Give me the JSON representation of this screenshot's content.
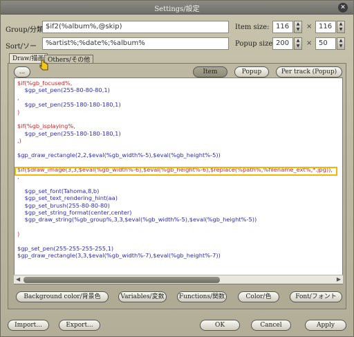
{
  "window": {
    "title": "Settings/設定",
    "close_glyph": "✕"
  },
  "form": {
    "group_label": "Group/分類:",
    "group_value": "$if2(%album%,@skip)",
    "sort_label": "Sort/ソー",
    "sort_value": "%artist%;%date%;%album%",
    "item_size_label": "Item size:",
    "item_size_w": "116",
    "item_size_h": "116",
    "popup_size_label": "Popup size:",
    "popup_size_w": "200",
    "popup_size_h": "50",
    "times": "×"
  },
  "tabs": [
    {
      "label": "Draw/描画"
    },
    {
      "label": "Others/その他"
    }
  ],
  "mode_buttons": {
    "left_stub": "...",
    "item": "Item",
    "popup": "Popup",
    "per_track": "Per track (Popup)"
  },
  "code_lines": [
    "$if(%gb_focused%,",
    "    $gp_set_pen(255-80-80-80,1)",
    ",",
    "    $gp_set_pen(255-180-180-180,1)",
    ")",
    "",
    "$if(%gb_isplaying%,",
    "    $gp_set_pen(255-180-180-180,1)",
    ",)",
    "",
    "$gp_draw_rectangle(2,2,$eval(%gb_width%-5),$eval(%gb_height%-5))",
    "",
    "$if($draw_image(3,3,$eval(%gb_width%-6),$eval(%gb_height%-6),$replace(%path%,%filename_ext%,*.jpg)),",
    ",",
    "",
    "    $gp_set_font(Tahoma,8,b)",
    "    $gp_set_text_rendering_hint(aa)",
    "    $gp_set_brush(255-80-80-80)",
    "    $gp_set_string_format(center,center)",
    "    $gp_draw_string(%gb_group%,3,3,$eval(%gb_width%-5),$eval(%gb_height%-5))",
    "",
    ")",
    "",
    "$gp_set_pen(255-255-255-255,1)",
    "$gp_draw_rectangle(3,3,$eval(%gb_width%-7),$eval(%gb_height%-7))",
    ""
  ],
  "bottom_buttons": {
    "background": "Background color/背景色",
    "variables": "Variables/変数",
    "functions": "Functions/関数",
    "color": "Color/色",
    "font": "Font/フォント"
  },
  "footer": {
    "import": "Import...",
    "export": "Export...",
    "ok": "OK",
    "cancel": "Cancel",
    "apply": "Apply"
  },
  "colors": {
    "highlight": "#f2b700",
    "code_blue": "#2b2bb5",
    "code_red": "#c62828"
  }
}
